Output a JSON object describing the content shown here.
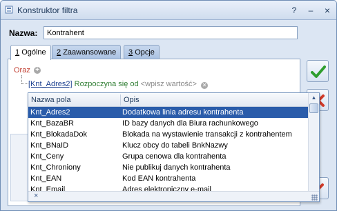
{
  "window": {
    "title": "Konstruktor filtra",
    "controls": {
      "help": "?",
      "minimize": "–",
      "close": "×"
    }
  },
  "form": {
    "name_label": "Nazwa:",
    "name_value": "Kontrahent"
  },
  "tabs": [
    {
      "num": "1",
      "label": "Ogólne",
      "active": true
    },
    {
      "num": "2",
      "label": "Zaawansowane",
      "active": false
    },
    {
      "num": "3",
      "label": "Opcje",
      "active": false
    }
  ],
  "filter": {
    "root_label": "Oraz",
    "add_icon": "plus-circle-icon",
    "condition": {
      "field": "[Knt_Adres2]",
      "operator": "Rozpoczyna się od",
      "value_placeholder": "<wpisz wartość>",
      "remove_icon": "x-circle-icon"
    }
  },
  "dropdown": {
    "columns": [
      "Nazwa pola",
      "Opis"
    ],
    "rows": [
      {
        "name": "Knt_Adres2",
        "desc": "Dodatkowa linia adresu kontrahenta",
        "selected": true
      },
      {
        "name": "Knt_BazaBR",
        "desc": "ID bazy danych dla Biura rachunkowego",
        "selected": false
      },
      {
        "name": "Knt_BlokadaDok",
        "desc": "Blokada na wystawienie transakcji z kontrahentem",
        "selected": false
      },
      {
        "name": "Knt_BNaID",
        "desc": "Klucz obcy do tabeli BnkNazwy",
        "selected": false
      },
      {
        "name": "Knt_Ceny",
        "desc": "Grupa cenowa dla kontrahenta",
        "selected": false
      },
      {
        "name": "Knt_Chroniony",
        "desc": "Nie publikuj danych kontrahenta",
        "selected": false
      },
      {
        "name": "Knt_EAN",
        "desc": "Kod EAN kontrahenta",
        "selected": false
      },
      {
        "name": "Knt_Email",
        "desc": "Adres elektroniczny e-mail",
        "selected": false
      }
    ],
    "close_glyph": "×",
    "scroll_up_glyph": "▲"
  },
  "side_buttons": {
    "ok_icon": "checkmark-icon",
    "cancel_icon": "cancel-icon",
    "clear_icon": "clear-filter-icon"
  },
  "colors": {
    "selection": "#2a5caa",
    "accent_green": "#2e9e2e",
    "cancel_red": "#d23b2a"
  }
}
